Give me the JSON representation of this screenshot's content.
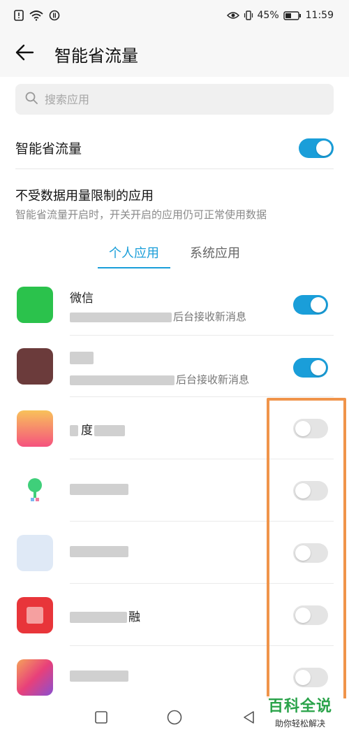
{
  "status_bar": {
    "battery": "45%",
    "time": "11:59"
  },
  "header": {
    "title": "智能省流量"
  },
  "search": {
    "placeholder": "搜索应用"
  },
  "main_toggle": {
    "label": "智能省流量",
    "on": true
  },
  "section": {
    "title": "不受数据用量限制的应用",
    "subtitle": "智能省流量开启时，开关开启的应用仍可正常使用数据"
  },
  "tabs": [
    {
      "label": "个人应用",
      "active": true
    },
    {
      "label": "系统应用",
      "active": false
    }
  ],
  "apps": [
    {
      "name": "微信",
      "desc": "后台接收新消息",
      "on": true,
      "icon_color": "#2bc24c"
    },
    {
      "name": "",
      "desc": "后台接收新消息",
      "on": true,
      "icon_color": "#6b3b3b"
    },
    {
      "name": "度",
      "desc": "",
      "on": false,
      "icon_color": "#f56a8a"
    },
    {
      "name": "",
      "desc": "",
      "on": false,
      "icon_color": "#3fcf7a"
    },
    {
      "name": "",
      "desc": "",
      "on": false,
      "icon_color": "#d8e6f5"
    },
    {
      "name": "融",
      "desc": "",
      "on": false,
      "icon_color": "#e8353a"
    },
    {
      "name": "",
      "desc": "",
      "on": false,
      "icon_color": "#e8407a"
    }
  ],
  "colors": {
    "accent": "#1a9ed9",
    "highlight": "#f0944a",
    "watermark": "#2aa34a"
  },
  "watermark": {
    "main": "百科全说",
    "sub": "助你轻松解决"
  }
}
